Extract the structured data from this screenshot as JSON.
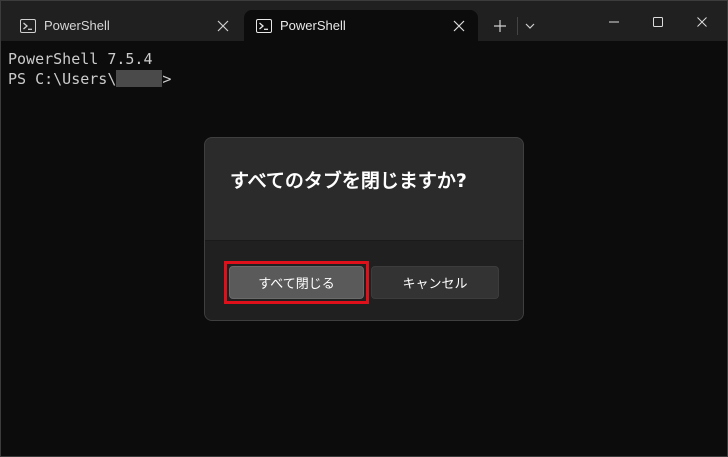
{
  "tabs": [
    {
      "label": "PowerShell",
      "active": false
    },
    {
      "label": "PowerShell",
      "active": true
    }
  ],
  "titlebar": {
    "new_tab_icon": "plus-icon",
    "dropdown_icon": "chevron-down-icon",
    "window_buttons": [
      "minimize-icon",
      "maximize-icon",
      "close-icon"
    ]
  },
  "terminal": {
    "line1": "PowerShell 7.5.4",
    "prompt_prefix": "PS C:\\Users\\",
    "prompt_suffix": ">"
  },
  "dialog": {
    "title": "すべてのタブを閉じますか?",
    "primary_button": "すべて閉じる",
    "secondary_button": "キャンセル"
  },
  "colors": {
    "terminal_bg": "#0c0c0c",
    "titlebar_bg": "#202020",
    "dialog_bg": "#2b2b2b",
    "highlight": "#e0101a"
  }
}
